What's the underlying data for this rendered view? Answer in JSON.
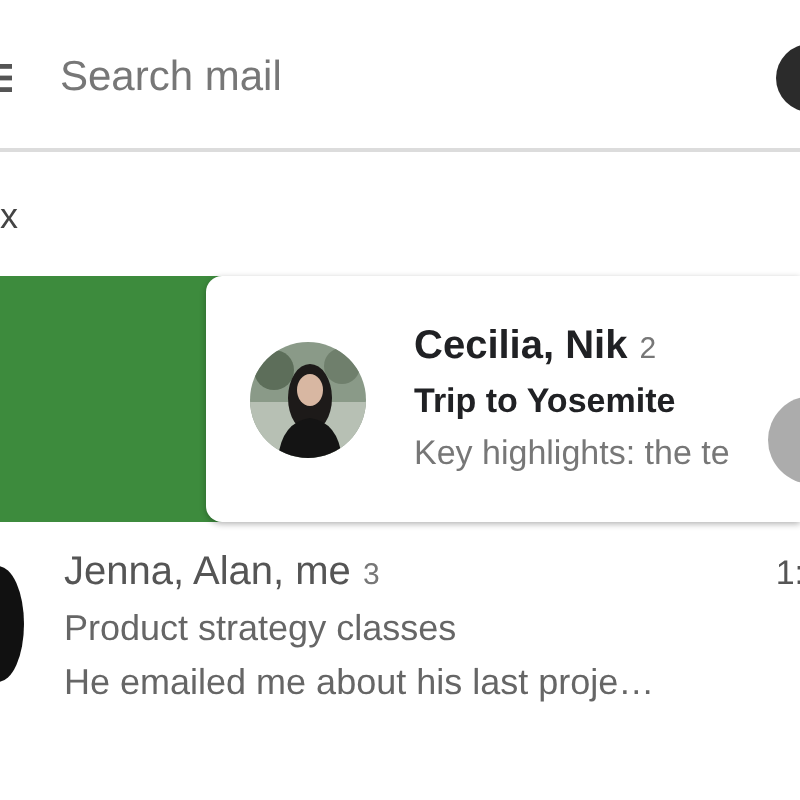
{
  "search": {
    "placeholder": "Search mail"
  },
  "folder_label": "x",
  "threads": [
    {
      "kind": "swiped",
      "senders": "Cecilia, Nik",
      "count": "2",
      "subject": "Trip to Yosemite",
      "snippet": "Key highlights: the te",
      "unread": true
    },
    {
      "kind": "normal",
      "senders": "Jenna, Alan, me",
      "count": "3",
      "time": "1:",
      "subject": "Product strategy classes",
      "snippet": "He emailed me about his last proje…",
      "unread": false
    }
  ]
}
